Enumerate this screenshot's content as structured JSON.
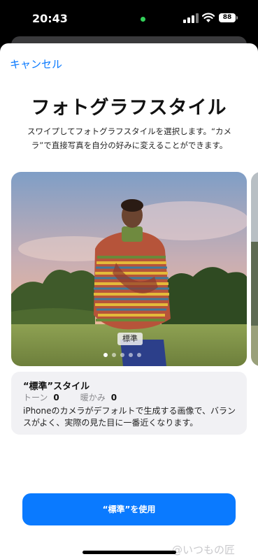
{
  "status_bar": {
    "time": "20:43",
    "battery": "88"
  },
  "sheet": {
    "cancel_label": "キャンセル",
    "title": "フォトグラフスタイル",
    "description": "スワイプしてフォトグラフスタイルを選択します。“カメラ”で直接写真を自分の好みに変えることができます。"
  },
  "carousel": {
    "badge": "標準",
    "page_count": 5,
    "active_page": 1
  },
  "info_card": {
    "style_name": "“標準”スタイル",
    "tone_label": "トーン",
    "tone_value": "0",
    "warmth_label": "暖かみ",
    "warmth_value": "0",
    "description": "iPhoneのカメラがデフォルトで生成する画像で、バランスがよく、実際の見た目に一番近くなります。"
  },
  "use_button_label": "“標準”を使用",
  "watermark": "@いつもの匠",
  "colors": {
    "accent": "#0a7aff",
    "camera_indicator": "#33d05a"
  },
  "icons": [
    "signal-icon",
    "wifi-icon",
    "battery-icon"
  ]
}
